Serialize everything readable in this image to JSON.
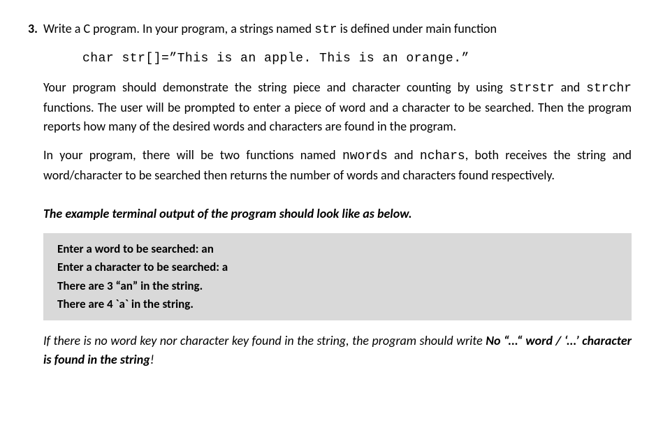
{
  "question": {
    "number": "3.",
    "intro_part1": "Write a C program. In your program, a strings named ",
    "intro_code1": "str",
    "intro_part2": " is defined under main function",
    "code_line_prefix": "char str[]=",
    "code_line_value": "”This is an apple. This is an orange.”",
    "para2_part1": "Your program should demonstrate the string piece and character counting by using ",
    "para2_code1": "strstr",
    "para2_part2": " and ",
    "para2_code2": "strchr",
    "para2_part3": " functions. The user will be prompted to enter a piece of word and a character to be searched. Then the program reports how many of the desired words and characters are found in the program.",
    "para3_part1": "In your program, there will be two functions named ",
    "para3_code1": "nwords",
    "para3_part2": " and  ",
    "para3_code2": "nchars",
    "para3_part3": ", both receives the string and word/character to be searched then returns the number of words and characters found respectively.",
    "example_heading": "The example terminal output of the program should look like as below.",
    "terminal": {
      "line1": "Enter a word to be searched: an",
      "line2": "Enter a character to be searched: a",
      "line3": "There are 3 “an” in the string.",
      "line4": "There are 4 `a` in the string."
    },
    "footer_part1": "If there is no word key nor character key found in the string, the program should write ",
    "footer_part2": "No “...“  word / ‘...’ character is found in the string",
    "footer_part3": "!"
  }
}
